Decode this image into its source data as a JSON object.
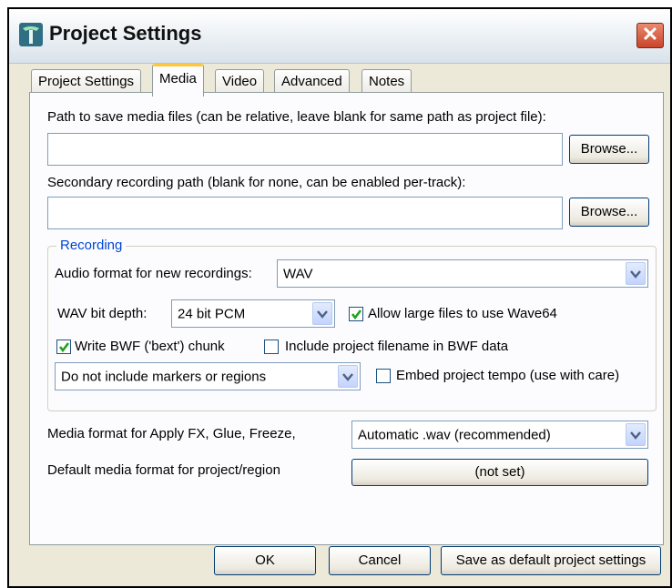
{
  "window": {
    "title": "Project Settings",
    "close_glyph": "✕",
    "icon": "reaper-app-icon"
  },
  "tabs": [
    "Project Settings",
    "Media",
    "Video",
    "Advanced",
    "Notes"
  ],
  "active_tab": "Media",
  "media": {
    "path_label": "Path to save media files (can be relative, leave blank for same path as project file):",
    "path_value": "",
    "browse_label": "Browse...",
    "secondary_label": "Secondary recording path (blank for none, can be enabled per-track):",
    "secondary_value": "",
    "browse2_label": "Browse..."
  },
  "recording": {
    "group_label": "Recording",
    "audio_format_label": "Audio format for new recordings:",
    "audio_format_value": "WAV",
    "bit_depth_label": "WAV bit depth:",
    "bit_depth_value": "24 bit PCM",
    "wave64_label": "Allow large files to use Wave64",
    "wave64_checked": true,
    "bwf_label": "Write BWF ('bext') chunk",
    "bwf_checked": true,
    "include_filename_label": "Include project filename in BWF data",
    "include_filename_checked": false,
    "markers_value": "Do not include markers or regions",
    "embed_tempo_label": "Embed project tempo (use with care)",
    "embed_tempo_checked": false
  },
  "formats": {
    "apply_fx_label": "Media format for Apply FX, Glue, Freeze,",
    "apply_fx_value": "Automatic .wav (recommended)",
    "default_format_label": "Default media format for project/region",
    "default_format_value": "(not set)"
  },
  "footer": {
    "ok_label": "OK",
    "cancel_label": "Cancel",
    "save_default_label": "Save as default project settings"
  },
  "colors": {
    "accent_tab": "#ffc83c",
    "group_legend": "#0046d5",
    "close_button": "#c9442a",
    "check": "#21a121"
  }
}
